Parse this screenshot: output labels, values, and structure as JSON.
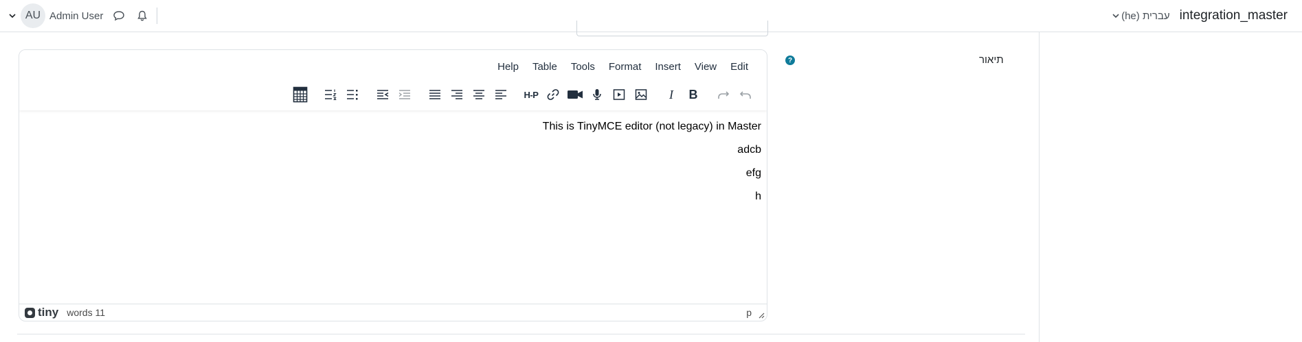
{
  "navbar": {
    "site_name": "integration_master",
    "language": "עברית (he)",
    "user_initials": "AU",
    "user_name": "Admin User"
  },
  "form": {
    "description_label": "תיאור",
    "help_glyph": "?"
  },
  "editor": {
    "menubar": [
      "Edit",
      "View",
      "Insert",
      "Format",
      "Tools",
      "Table",
      "Help"
    ],
    "toolbar_icons": [
      "undo-icon",
      "redo-icon",
      "bold-icon",
      "italic-icon",
      "image-icon",
      "media-icon",
      "record-audio-icon",
      "record-video-icon",
      "link-icon",
      "h5p-icon",
      "align-left-icon",
      "align-center-icon",
      "align-right-icon",
      "align-justify-icon",
      "indent-icon",
      "outdent-icon",
      "bullet-list-icon",
      "numbered-list-icon",
      "equation-icon"
    ],
    "h5p_label": "H-P",
    "bold_label": "B",
    "italic_label": "I",
    "content": [
      "This is TinyMCE editor (not legacy) in Master",
      "adcb",
      "efg",
      "h"
    ],
    "brand": "tiny",
    "word_count": "words 11",
    "element_path": "p"
  },
  "colors": {
    "help_icon": "#0f7b9a",
    "border": "#dee2e6",
    "toolbar_text": "#222f3e"
  }
}
